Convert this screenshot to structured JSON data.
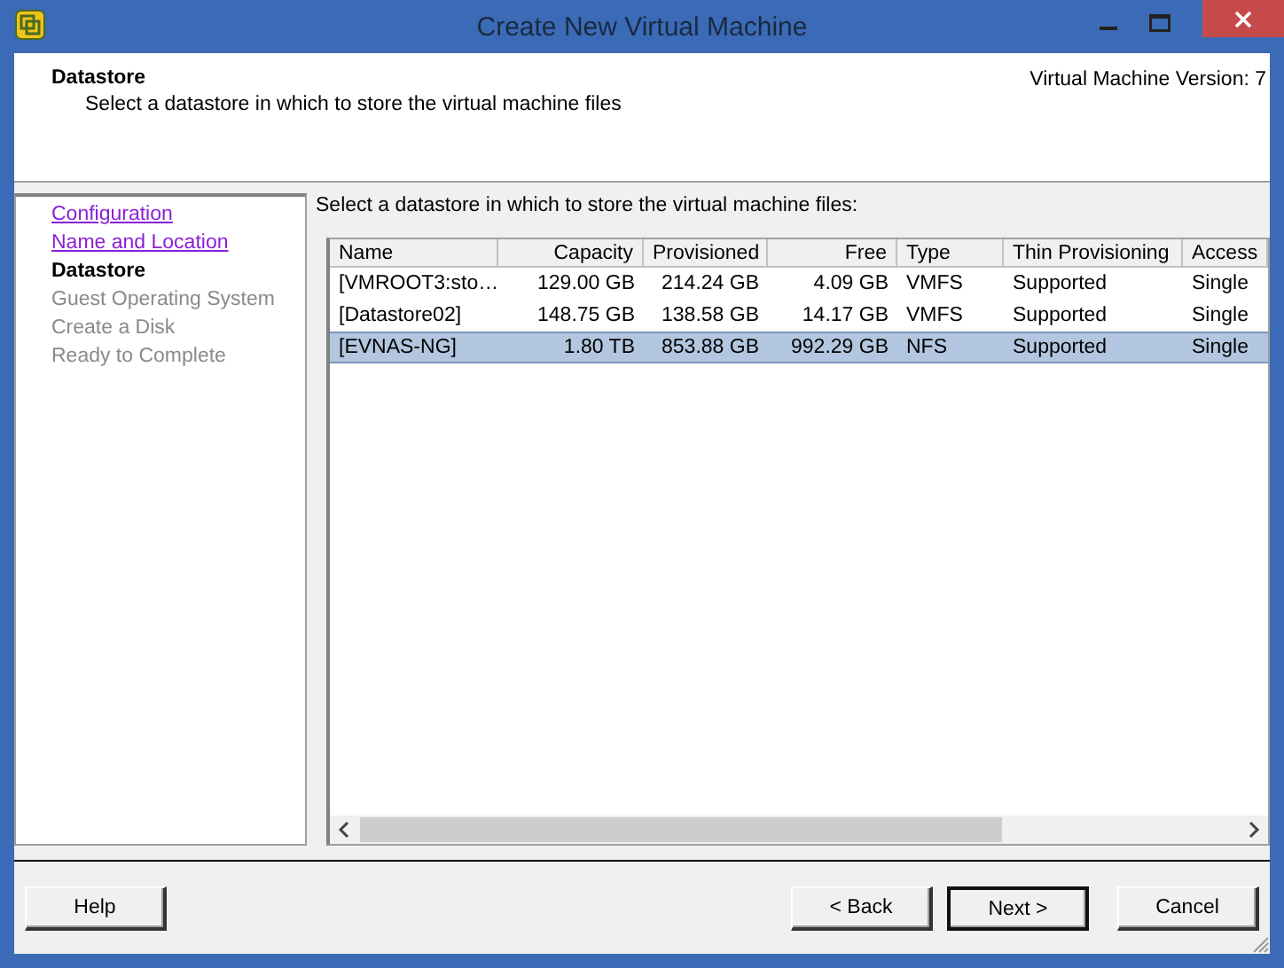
{
  "window": {
    "title": "Create New Virtual Machine"
  },
  "header": {
    "title": "Datastore",
    "subtitle": "Select a datastore in which to store the virtual machine files",
    "version": "Virtual Machine Version: 7"
  },
  "steps": [
    {
      "label": "Configuration",
      "completed": true,
      "selected": false
    },
    {
      "label": "Name and Location",
      "completed": true,
      "selected": false
    },
    {
      "label": "Datastore",
      "completed": false,
      "selected": true
    },
    {
      "label": "Guest Operating System",
      "completed": false,
      "selected": false
    },
    {
      "label": "Create a Disk",
      "completed": false,
      "selected": false
    },
    {
      "label": "Ready to Complete",
      "completed": false,
      "selected": false
    }
  ],
  "prompt": "Select a datastore in which to store the virtual machine files:",
  "table": {
    "columns": [
      "Name",
      "Capacity",
      "Provisioned",
      "Free",
      "Type",
      "Thin Provisioning",
      "Access"
    ],
    "rows": [
      {
        "cells": [
          "[VMROOT3:sto…",
          "129.00 GB",
          "214.24 GB",
          "4.09 GB",
          "VMFS",
          "Supported",
          "Single"
        ],
        "selected": false
      },
      {
        "cells": [
          "[Datastore02]",
          "148.75 GB",
          "138.58 GB",
          "14.17 GB",
          "VMFS",
          "Supported",
          "Single"
        ],
        "selected": false
      },
      {
        "cells": [
          "[EVNAS-NG]",
          "1.80 TB",
          "853.88 GB",
          "992.29 GB",
          "NFS",
          "Supported",
          "Single"
        ],
        "selected": true
      }
    ]
  },
  "buttons": {
    "help": "Help",
    "back": "< Back",
    "next": "Next >",
    "cancel": "Cancel"
  }
}
